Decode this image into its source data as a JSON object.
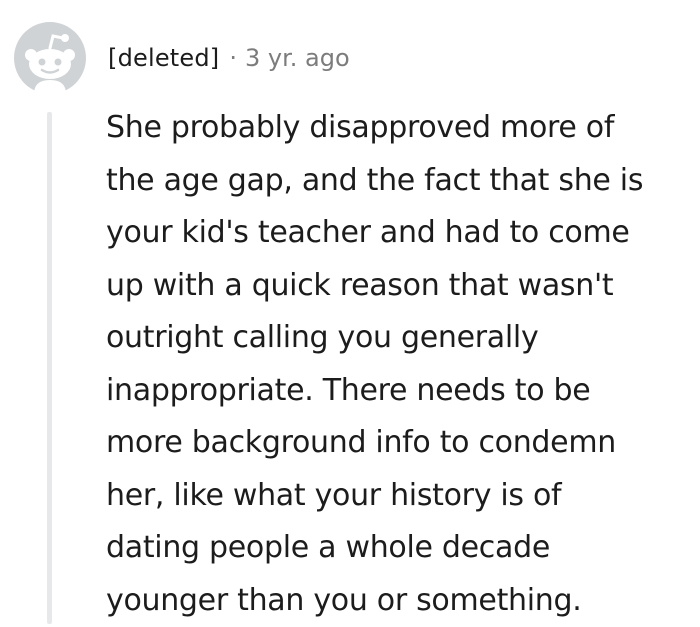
{
  "comment": {
    "author": "[deleted]",
    "separator": "·",
    "timestamp": "3 yr. ago",
    "body_lines": [
      "She probably disapproved more of",
      "the age gap, and the fact that she is",
      "your kid's teacher and had to come",
      "up with a quick reason that wasn't",
      "outright calling you generally",
      "inappropriate. There needs to be",
      "more background info to condemn",
      "her, like what your history is of",
      "dating people a whole decade",
      "younger than you or something."
    ]
  },
  "icons": {
    "avatar": "reddit-snoo-avatar-icon"
  },
  "colors": {
    "text": "#1c1c1c",
    "meta": "#7c7c7c",
    "avatar": "#cfd3d6",
    "thread_line": "#e6e8ea"
  }
}
